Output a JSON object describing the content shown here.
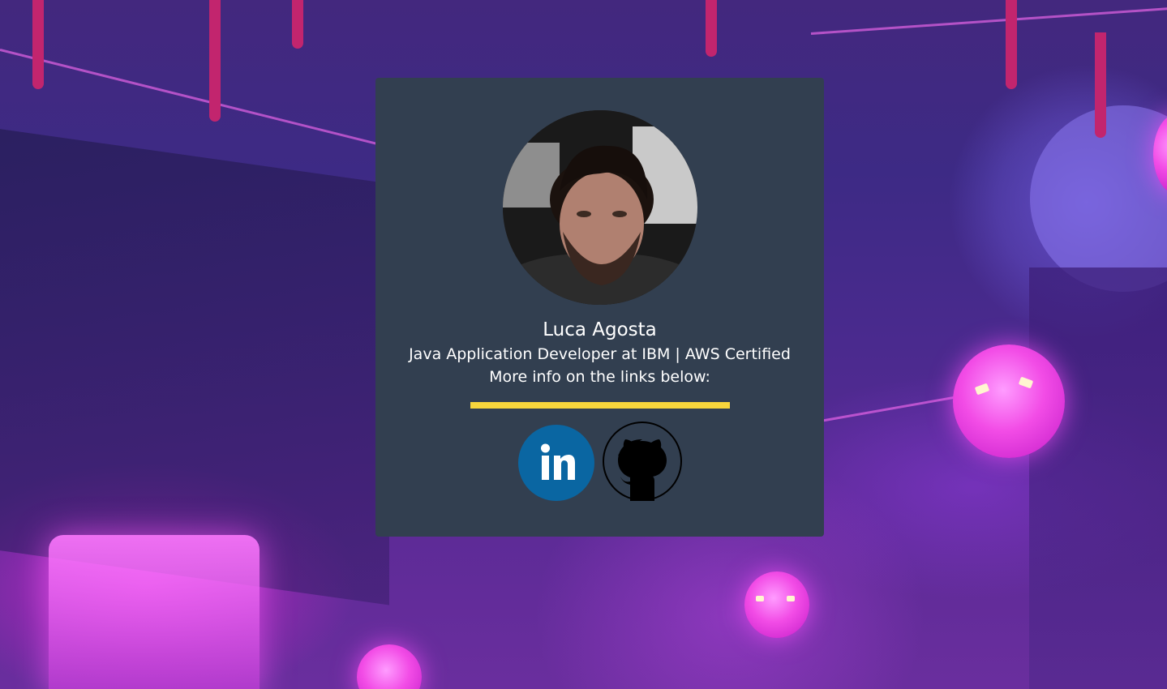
{
  "profile": {
    "name": "Luca Agosta",
    "subtitle": "Java Application Developer at IBM | AWS Certified",
    "info": "More info on the links below:",
    "avatar_alt": "profile-photo"
  },
  "links": [
    {
      "name": "linkedin",
      "icon": "linkedin-icon"
    },
    {
      "name": "github",
      "icon": "github-icon"
    }
  ],
  "colors": {
    "card_background": "#323f50",
    "divider": "#f8d63c",
    "linkedin": "#0a66a2",
    "text": "#ffffff"
  }
}
